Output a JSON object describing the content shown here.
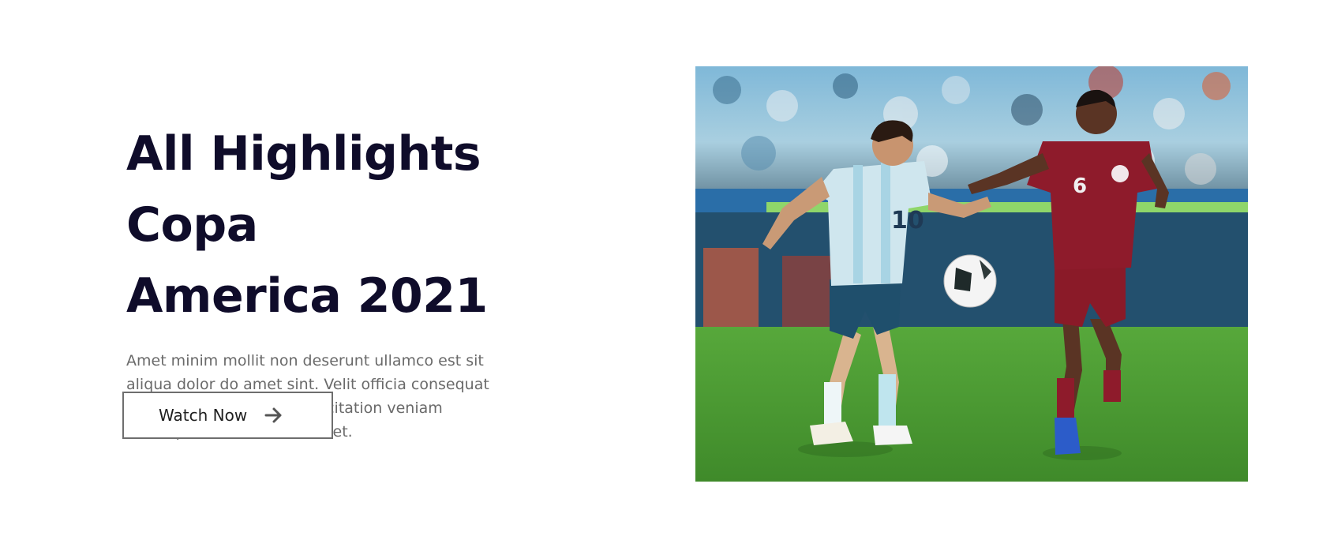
{
  "hero": {
    "title_line1": "All Highlights Copa",
    "title_line2": "America 2021",
    "description": "Amet minim mollit non deserunt ullamco est sit aliqua dolor do amet sint. Velit officia consequat duis enim velit mollit. Exercitation veniam consequat sunt nostrud amet.",
    "button_label": "Watch Now",
    "button_icon": "arrow-right-icon"
  },
  "photo": {
    "jersey_left": "10",
    "jersey_right": "6"
  },
  "colors": {
    "title": "#0f0c2a",
    "text": "#6a6a6a",
    "button_border": "#6e6e6e",
    "pitch": "#4a9a34",
    "kit_red": "#8e1b2b",
    "kit_light_blue": "#cfe6ee"
  }
}
